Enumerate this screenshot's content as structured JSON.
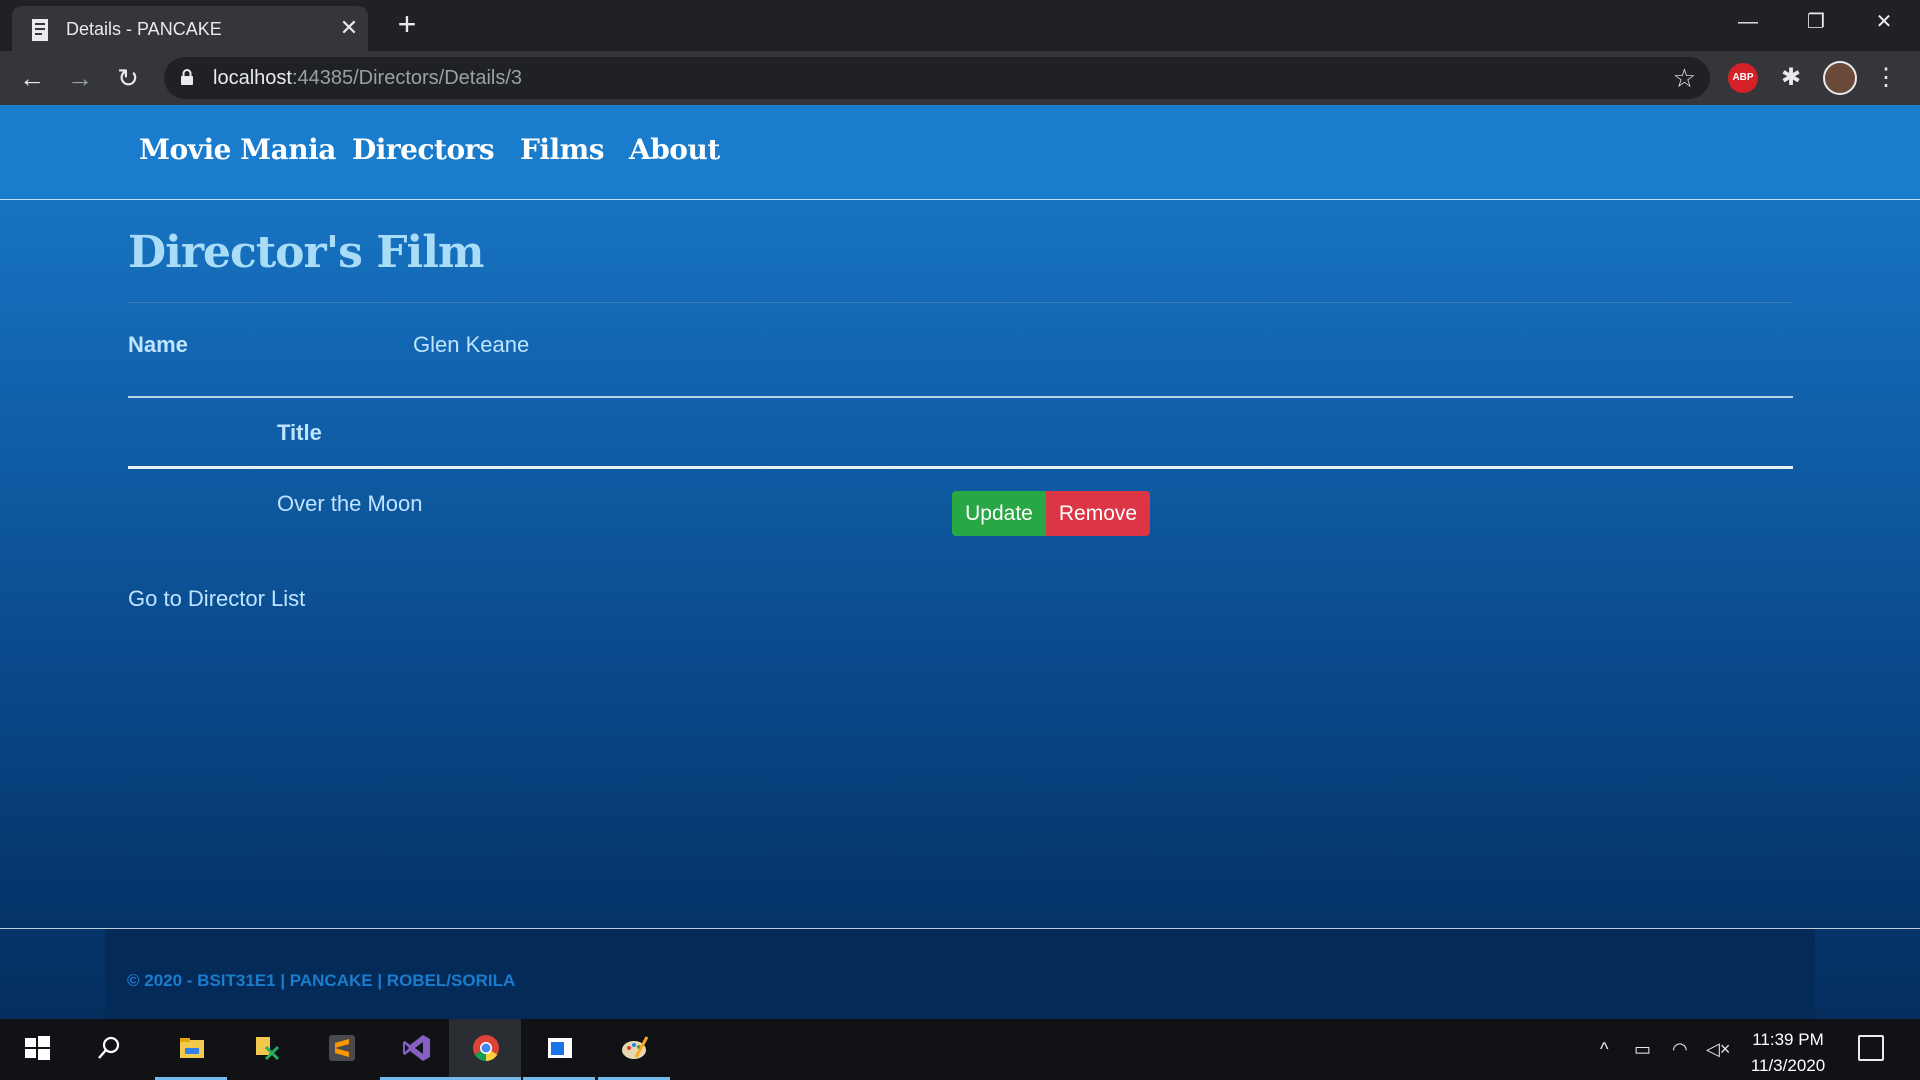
{
  "browser": {
    "tab_title": "Details - PANCAKE",
    "tab_close": "✕",
    "new_tab": "+",
    "window_controls": {
      "minimize": "—",
      "restore": "❐",
      "close": "✕"
    },
    "nav": {
      "back": "←",
      "forward": "→",
      "reload": "↻"
    },
    "url_host": "localhost",
    "url_rest": ":44385/Directors/Details/3",
    "bookmark_icon": "☆",
    "extensions": {
      "abp_label": "ABP",
      "puzzle": "✱",
      "menu": "⋮"
    }
  },
  "site": {
    "nav": [
      "Movie Mania",
      "Directors",
      "Films",
      "About"
    ],
    "heading": "Director's Film",
    "name_label": "Name",
    "name_value": "Glen Keane",
    "table": {
      "header": "Title",
      "rows": [
        {
          "title": "Over the Moon",
          "update_label": "Update",
          "remove_label": "Remove"
        }
      ]
    },
    "back_link": "Go to Director List",
    "footer": "© 2020 - BSIT31E1 | PANCAKE | ROBEL/SORILA"
  },
  "colors": {
    "page_top": "#1a7ccd",
    "page_bottom": "#052e5e",
    "heading": "#a9dcf7",
    "text": "#bfe4ff",
    "update_button": "#28a745",
    "remove_button": "#dc3545",
    "footer_text": "#1a7ccd"
  },
  "taskbar": {
    "apps": [
      "windows-start",
      "search",
      "file-explorer",
      "app-green",
      "sublime-text",
      "visual-studio",
      "chrome",
      "app-window",
      "paint"
    ],
    "time": "11:39 PM",
    "date": "11/3/2020",
    "tray_up": "^",
    "tray_battery": "▭",
    "tray_wifi": "◠",
    "tray_volume": "◁×"
  }
}
